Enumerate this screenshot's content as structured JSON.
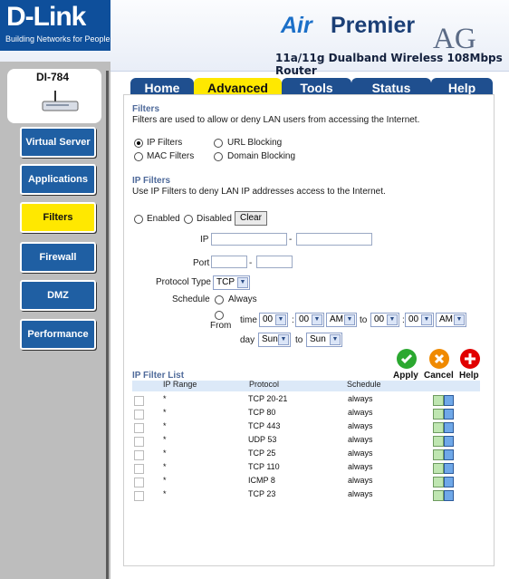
{
  "brand": {
    "name": "D-Link",
    "tagline": "Building Networks for People"
  },
  "product": {
    "air": "Air",
    "premier": "Premier",
    "ag": "AG",
    "description": "11a/11g Dualband Wireless 108Mbps Router"
  },
  "model": "DI-784",
  "tabs": [
    {
      "label": "Home"
    },
    {
      "label": "Advanced"
    },
    {
      "label": "Tools"
    },
    {
      "label": "Status"
    },
    {
      "label": "Help"
    }
  ],
  "sidebar": {
    "items": [
      {
        "label": "Virtual Server"
      },
      {
        "label": "Applications"
      },
      {
        "label": "Filters"
      },
      {
        "label": "Firewall"
      },
      {
        "label": "DMZ"
      },
      {
        "label": "Performance"
      }
    ]
  },
  "filters": {
    "title": "Filters",
    "description": "Filters are used to allow or deny LAN users from accessing the Internet.",
    "options": [
      {
        "label": "IP Filters"
      },
      {
        "label": "URL Blocking"
      },
      {
        "label": "MAC Filters"
      },
      {
        "label": "Domain Blocking"
      }
    ]
  },
  "ip_filters": {
    "title": "IP Filters",
    "description": "Use IP Filters to deny LAN IP addresses access to the Internet.",
    "enabled_label": "Enabled",
    "disabled_label": "Disabled",
    "clear_label": "Clear",
    "ip_label": "IP",
    "port_label": "Port",
    "protocol_label": "Protocol Type",
    "protocol_value": "TCP",
    "schedule_label": "Schedule",
    "always_label": "Always",
    "from_label": "From",
    "time_label": "time",
    "day_label": "day",
    "to_label": "to",
    "time_from_hour": "00",
    "time_from_min": "00",
    "time_from_ampm": "AM",
    "time_to_hour": "00",
    "time_to_min": "00",
    "time_to_ampm": "AM",
    "day_from": "Sun",
    "day_to": "Sun"
  },
  "actions": {
    "apply": "Apply",
    "cancel": "Cancel",
    "help": "Help"
  },
  "list": {
    "title": "IP Filter List",
    "columns": [
      "IP Range",
      "Protocol",
      "Schedule"
    ],
    "rows": [
      {
        "ip": "*",
        "protocol": "TCP 20-21",
        "schedule": "always"
      },
      {
        "ip": "*",
        "protocol": "TCP 80",
        "schedule": "always"
      },
      {
        "ip": "*",
        "protocol": "TCP 443",
        "schedule": "always"
      },
      {
        "ip": "*",
        "protocol": "UDP 53",
        "schedule": "always"
      },
      {
        "ip": "*",
        "protocol": "TCP 25",
        "schedule": "always"
      },
      {
        "ip": "*",
        "protocol": "TCP 110",
        "schedule": "always"
      },
      {
        "ip": "*",
        "protocol": "ICMP 8",
        "schedule": "always"
      },
      {
        "ip": "*",
        "protocol": "TCP 23",
        "schedule": "always"
      }
    ]
  },
  "colors": {
    "brand_blue": "#0e4f9b",
    "tab_blue": "#1f4f8f",
    "active_yellow": "#ffe800",
    "section_blue": "#4f6a9a"
  }
}
